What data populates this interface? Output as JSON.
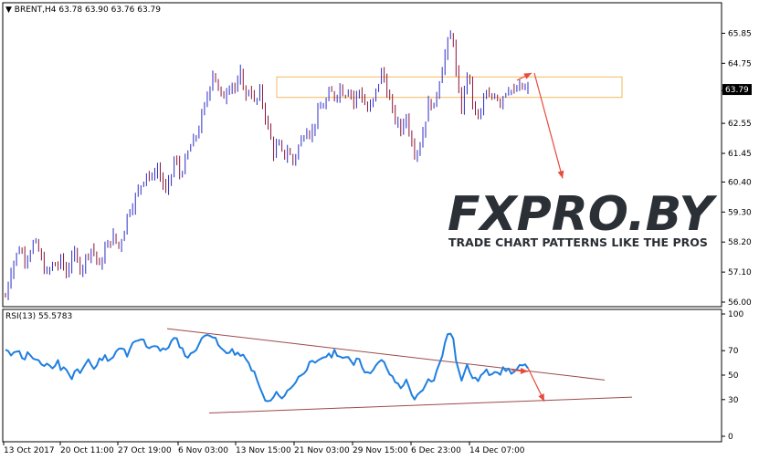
{
  "title": {
    "main": "▼ BRENT,H4  63.78 63.90 63.76 63.79",
    "rsi": "RSI(13) 55.5783"
  },
  "price_badge": "63.79",
  "watermark": {
    "logo": "FXPRO.BY",
    "tagline": "TRADE CHART PATTERNS LIKE THE PROS"
  },
  "colors": {
    "bull": "#2d2dc8",
    "bear": "#8b1538",
    "rsi": "#1f7fe0",
    "trendline": "#9b4a4a",
    "arrow": "#e84a3c",
    "zone": "#f3b95f",
    "badge_bg": "#000000"
  },
  "chart_data": [
    {
      "type": "candlestick",
      "symbol": "BRENT",
      "timeframe": "H4",
      "ylim": [
        55.9,
        66.4
      ],
      "yticks": [
        "65.85",
        "64.75",
        "63.75",
        "62.55",
        "61.45",
        "60.40",
        "59.30",
        "58.20",
        "57.10",
        "56.00"
      ],
      "xticks": [
        "13 Oct 2017",
        "20 Oct 11:00",
        "27 Oct 19:00",
        "6 Nov 03:00",
        "13 Nov 15:00",
        "21 Nov 03:00",
        "29 Nov 15:00",
        "6 Dec 23:00",
        "14 Dec 07:00"
      ],
      "close_path": [
        56.2,
        57.1,
        57.6,
        58.0,
        57.6,
        57.8,
        58.2,
        57.9,
        57.3,
        57.0,
        57.4,
        57.3,
        57.6,
        56.9,
        57.8,
        57.6,
        57.2,
        57.6,
        58.0,
        57.8,
        57.2,
        57.9,
        58.2,
        58.4,
        58.0,
        58.5,
        59.3,
        59.6,
        60.0,
        60.4,
        60.8,
        60.4,
        61.0,
        60.6,
        60.0,
        60.5,
        61.3,
        60.7,
        61.0,
        61.6,
        61.9,
        62.3,
        63.0,
        63.6,
        64.5,
        63.9,
        63.4,
        63.8,
        64.1,
        63.7,
        64.4,
        63.5,
        63.9,
        63.2,
        63.7,
        63.0,
        62.2,
        61.5,
        61.8,
        61.3,
        61.6,
        61.1,
        61.6,
        62.0,
        62.4,
        62.1,
        62.8,
        63.1,
        63.3,
        63.7,
        63.5,
        63.9,
        63.6,
        63.9,
        63.3,
        63.8,
        63.4,
        63.0,
        63.3,
        63.9,
        64.5,
        63.8,
        63.1,
        62.6,
        62.3,
        62.9,
        62.1,
        61.5,
        61.7,
        62.5,
        63.4,
        63.1,
        64.0,
        64.8,
        65.5,
        65.9,
        63.8,
        63.0,
        64.5,
        63.6,
        62.7,
        63.0,
        63.6,
        63.4,
        63.7,
        63.3,
        63.7,
        63.9,
        63.6,
        63.9,
        63.8,
        63.79
      ],
      "horizontal_zone": [
        63.5,
        64.25
      ],
      "projection": {
        "from": 63.79,
        "to": 60.4
      }
    },
    {
      "type": "line",
      "indicator": "RSI(13)",
      "last_value": 55.5783,
      "ylim": [
        0,
        100
      ],
      "yticks": [
        "100",
        "70",
        "50",
        "30",
        "0"
      ],
      "values": [
        70,
        66,
        72,
        68,
        63,
        69,
        62,
        60,
        58,
        60,
        55,
        62,
        54,
        57,
        46,
        56,
        50,
        60,
        62,
        56,
        62,
        66,
        59,
        66,
        70,
        72,
        65,
        75,
        77,
        80,
        74,
        73,
        76,
        69,
        71,
        76,
        80,
        75,
        68,
        64,
        70,
        75,
        80,
        86,
        82,
        76,
        70,
        68,
        72,
        65,
        68,
        62,
        58,
        50,
        40,
        30,
        27,
        32,
        36,
        30,
        38,
        42,
        46,
        52,
        56,
        60,
        58,
        64,
        66,
        65,
        70,
        66,
        62,
        64,
        60,
        66,
        56,
        50,
        56,
        58,
        62,
        56,
        48,
        44,
        40,
        46,
        38,
        30,
        34,
        38,
        48,
        44,
        58,
        70,
        84,
        86,
        56,
        46,
        58,
        50,
        45,
        49,
        53,
        51,
        55,
        52,
        55,
        54,
        52,
        56,
        57,
        55.5783
      ],
      "trendlines": [
        {
          "from": 88,
          "to": 46
        },
        {
          "from": 19,
          "to": 32
        }
      ],
      "projection": {
        "from": 56,
        "to": 30
      }
    }
  ]
}
